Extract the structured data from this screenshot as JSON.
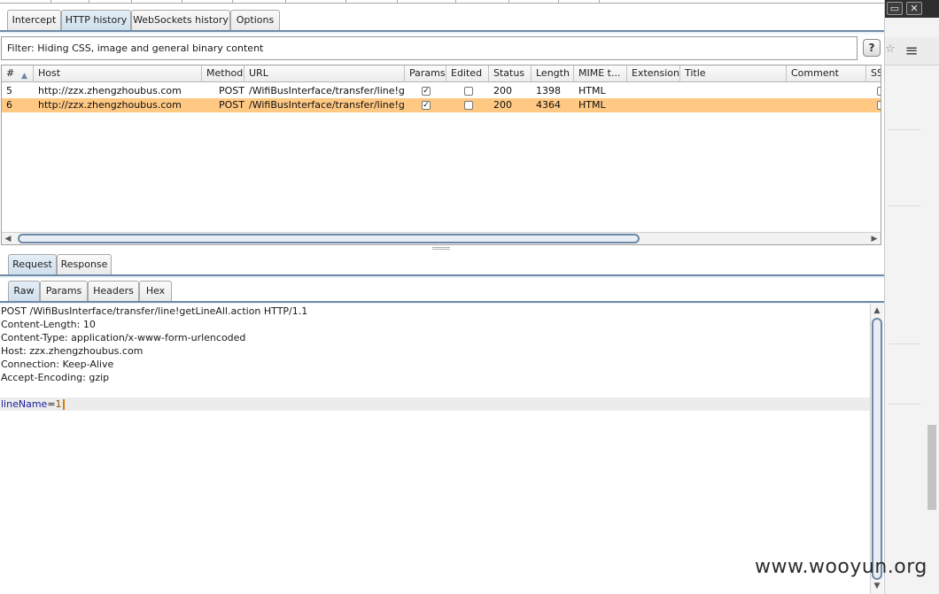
{
  "window_controls": {
    "restore": "▭",
    "close": "✕"
  },
  "proxy_tabs": [
    "Intercept",
    "HTTP history",
    "WebSockets history",
    "Options"
  ],
  "filter": {
    "text": "Filter:  Hiding CSS, image and general binary content",
    "help": "?"
  },
  "table": {
    "columns": [
      "#",
      "Host",
      "Method",
      "URL",
      "Params",
      "Edited",
      "Status",
      "Length",
      "MIME t...",
      "Extension",
      "Title",
      "Comment",
      "SS"
    ],
    "rows": [
      {
        "num": "5",
        "host": "http://zzx.zhengzhoubus.com",
        "method": "POST",
        "url": "/WifiBusInterface/transfer/line!g...",
        "params": true,
        "edited": false,
        "status": "200",
        "length": "1398",
        "mime": "HTML",
        "extension": "",
        "title": "",
        "comment": "",
        "selected": false
      },
      {
        "num": "6",
        "host": "http://zzx.zhengzhoubus.com",
        "method": "POST",
        "url": "/WifiBusInterface/transfer/line!g...",
        "params": true,
        "edited": false,
        "status": "200",
        "length": "4364",
        "mime": "HTML",
        "extension": "",
        "title": "",
        "comment": "",
        "selected": true
      }
    ]
  },
  "message_tabs": [
    "Request",
    "Response"
  ],
  "view_tabs": [
    "Raw",
    "Params",
    "Headers",
    "Hex"
  ],
  "request": {
    "lines": [
      "POST /WifiBusInterface/transfer/line!getLineAll.action HTTP/1.1",
      "Content-Length: 10",
      "Content-Type: application/x-www-form-urlencoded",
      "Host: zzx.zhengzhoubus.com",
      "Connection: Keep-Alive",
      "Accept-Encoding: gzip"
    ],
    "body_name": "lineName",
    "body_sep": "=",
    "body_value": "1"
  },
  "watermark": "www.wooyun.org",
  "colors": {
    "selected_row": "#ffc883",
    "accent": "#6e8aa6"
  }
}
